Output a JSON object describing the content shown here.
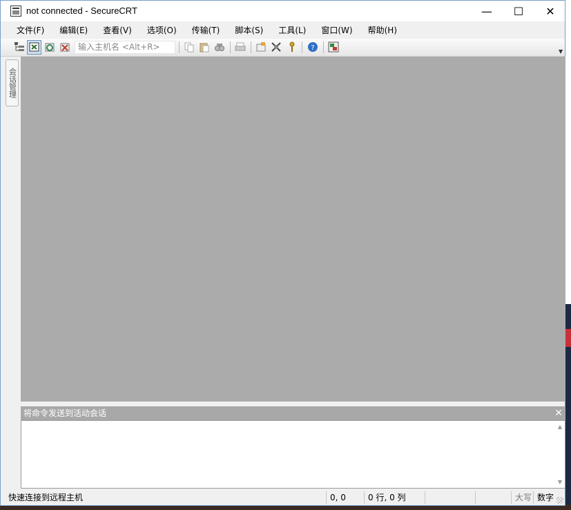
{
  "window": {
    "title": "not connected - SecureCRT",
    "controls": {
      "minimize": "—",
      "maximize": "☐",
      "close": "✕"
    }
  },
  "menubar": {
    "items": [
      {
        "label": "文件(F)"
      },
      {
        "label": "编辑(E)"
      },
      {
        "label": "查看(V)"
      },
      {
        "label": "选项(O)"
      },
      {
        "label": "传输(T)"
      },
      {
        "label": "脚本(S)"
      },
      {
        "label": "工具(L)"
      },
      {
        "label": "窗口(W)"
      },
      {
        "label": "帮助(H)"
      }
    ]
  },
  "toolbar": {
    "host_placeholder": "输入主机名 <Alt+R>",
    "icons": [
      "session-manager-icon",
      "connect-icon",
      "reconnect-icon",
      "disconnect-icon",
      "copy-icon",
      "paste-icon",
      "find-icon",
      "print-icon",
      "session-options-icon",
      "global-options-icon",
      "key-icon",
      "help-icon",
      "sftp-icon"
    ]
  },
  "sidebar": {
    "session_tab_label": "会话管理"
  },
  "command_window": {
    "header_label": "将命令发送到活动会话",
    "close": "✕"
  },
  "statusbar": {
    "message": "快速连接到远程主机",
    "cursor": "0, 0",
    "rows_cols": "0 行, 0 列",
    "caps": "大写",
    "num": "数字"
  },
  "colors": {
    "terminal_bg": "#ababab",
    "window_border": "#7a9ec7"
  }
}
